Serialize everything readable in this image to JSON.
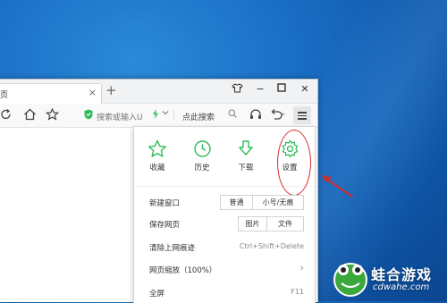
{
  "tab": {
    "label": "页",
    "close": "×"
  },
  "newtab": "+",
  "window": {
    "skin": "👕",
    "minimize": "−",
    "maximize": "☐",
    "close": "✕"
  },
  "toolbar": {
    "address_placeholder": "搜索或输入U",
    "search_label": "点此搜索"
  },
  "menu": {
    "quick": [
      {
        "label": "收藏",
        "icon": "star-icon"
      },
      {
        "label": "历史",
        "icon": "clock-icon"
      },
      {
        "label": "下载",
        "icon": "download-icon"
      },
      {
        "label": "设置",
        "icon": "gear-icon"
      }
    ],
    "new_window": {
      "label": "新建窗口",
      "opt1": "普通",
      "opt2": "小号/无痕"
    },
    "save_page": {
      "label": "保存网页",
      "opt1": "图片",
      "opt2": "文件"
    },
    "clear_traces": {
      "label": "清除上网痕迹",
      "shortcut": "Ctrl+Shift+Delete"
    },
    "zoom": {
      "label": "网页缩放（100%）",
      "arrow": "›"
    },
    "fullscreen": {
      "label": "全屏",
      "shortcut": "F11"
    }
  },
  "watermark": {
    "title": "蛙合游戏",
    "url": "cdwahe.com"
  },
  "colors": {
    "accent_green": "#2ebd59",
    "highlight_red": "#d42a2a"
  }
}
